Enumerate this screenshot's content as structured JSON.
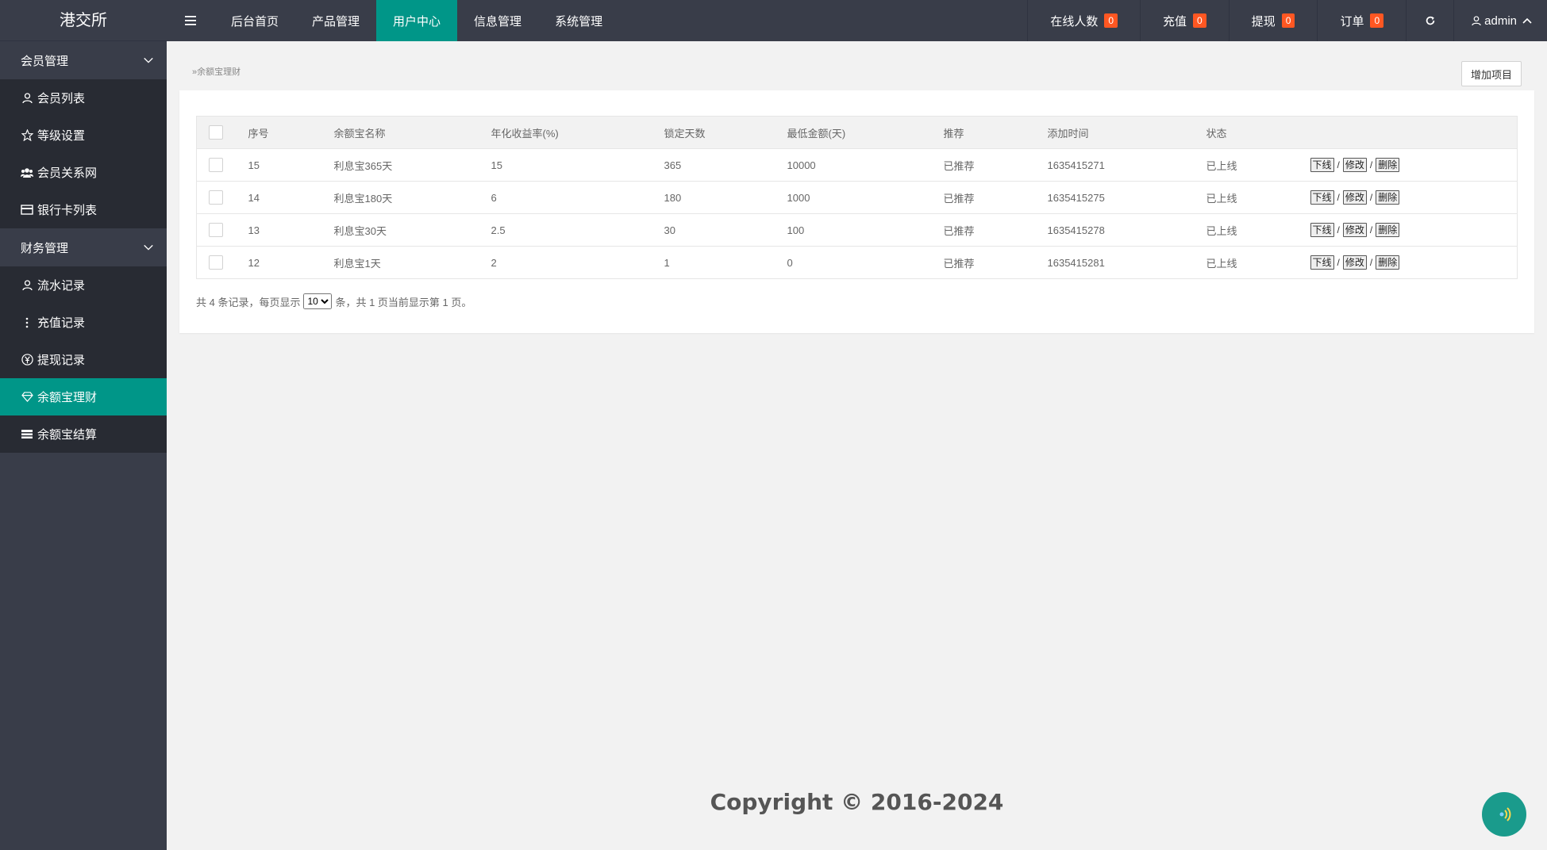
{
  "app": {
    "logo": "港交所"
  },
  "topnav": {
    "tabs": [
      {
        "label": "后台首页"
      },
      {
        "label": "产品管理"
      },
      {
        "label": "用户中心"
      },
      {
        "label": "信息管理"
      },
      {
        "label": "系统管理"
      }
    ],
    "active_tab": "用户中心",
    "stats": [
      {
        "label": "在线人数",
        "count": "0"
      },
      {
        "label": "充值",
        "count": "0"
      },
      {
        "label": "提现",
        "count": "0"
      },
      {
        "label": "订单",
        "count": "0"
      }
    ],
    "user": "admin"
  },
  "sidebar": {
    "groups": [
      {
        "title": "会员管理",
        "items": [
          {
            "label": "会员列表",
            "icon": "user-icon"
          },
          {
            "label": "等级设置",
            "icon": "star-icon"
          },
          {
            "label": "会员关系网",
            "icon": "users-icon"
          },
          {
            "label": "银行卡列表",
            "icon": "card-icon"
          }
        ]
      },
      {
        "title": "财务管理",
        "items": [
          {
            "label": "流水记录",
            "icon": "user-icon"
          },
          {
            "label": "充值记录",
            "icon": "more-vertical-icon"
          },
          {
            "label": "提现记录",
            "icon": "yen-icon"
          },
          {
            "label": "余额宝理财",
            "icon": "diamond-icon"
          },
          {
            "label": "余额宝结算",
            "icon": "list-icon"
          }
        ]
      }
    ],
    "active_item": "余额宝理财"
  },
  "main": {
    "breadcrumb": "»余额宝理财",
    "add_button": "增加项目",
    "table": {
      "headers": [
        "序号",
        "余额宝名称",
        "年化收益率(%)",
        "锁定天数",
        "最低金额(天)",
        "推荐",
        "添加时间",
        "状态"
      ],
      "rows": [
        {
          "id": "15",
          "name": "利息宝365天",
          "rate": "15",
          "days": "365",
          "min": "10000",
          "recommend": "已推荐",
          "time": "1635415271",
          "status": "已上线"
        },
        {
          "id": "14",
          "name": "利息宝180天",
          "rate": "6",
          "days": "180",
          "min": "1000",
          "recommend": "已推荐",
          "time": "1635415275",
          "status": "已上线"
        },
        {
          "id": "13",
          "name": "利息宝30天",
          "rate": "2.5",
          "days": "30",
          "min": "100",
          "recommend": "已推荐",
          "time": "1635415278",
          "status": "已上线"
        },
        {
          "id": "12",
          "name": "利息宝1天",
          "rate": "2",
          "days": "1",
          "min": "0",
          "recommend": "已推荐",
          "time": "1635415281",
          "status": "已上线"
        }
      ],
      "actions": {
        "offline": "下线",
        "edit": "修改",
        "delete": "删除",
        "separator": "/"
      }
    },
    "pager": {
      "prefix": "共 4 条记录，每页显示",
      "page_size": "10",
      "suffix": "条，共 1 页当前显示第 1 页。"
    }
  },
  "footer": {
    "copyright": "Copyright © 2016-2024"
  },
  "colors": {
    "accent": "#009688",
    "badge": "#ff5722",
    "sidebar_bg": "#393d49",
    "sidebar_sub_bg": "#282b33"
  }
}
